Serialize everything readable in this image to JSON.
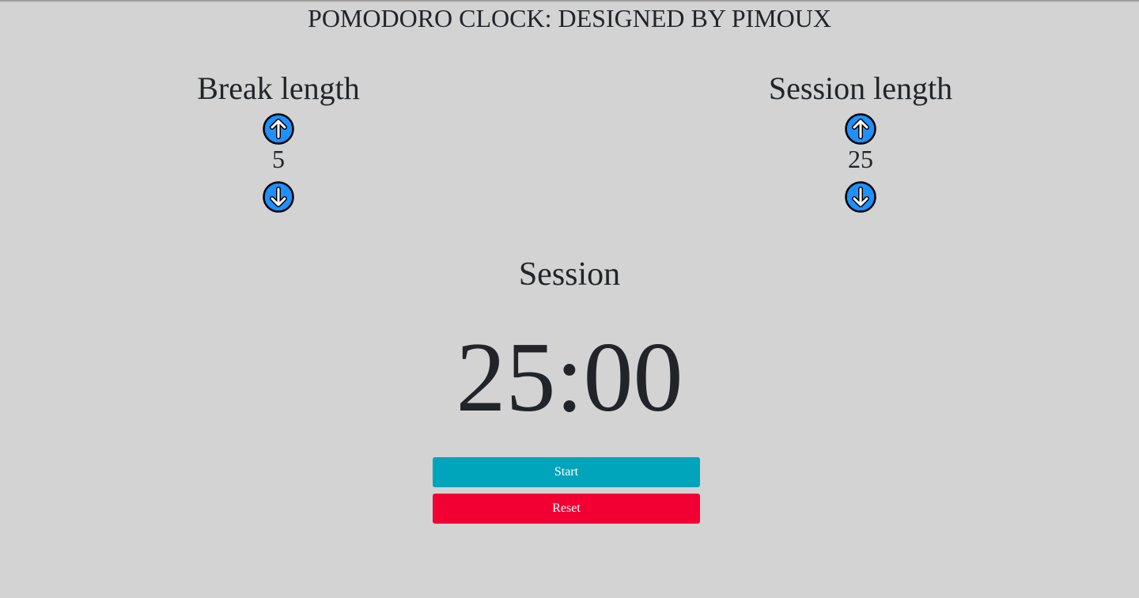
{
  "header": {
    "title": "POMODORO CLOCK: DESIGNED BY PIMOUX"
  },
  "break_control": {
    "label": "Break length",
    "value": "5"
  },
  "session_control": {
    "label": "Session length",
    "value": "25"
  },
  "timer": {
    "label": "Session",
    "time": "25:00"
  },
  "buttons": {
    "start_label": "Start",
    "reset_label": "Reset"
  },
  "icons": {
    "increment": "arrow-up-circle-icon",
    "decrement": "arrow-down-circle-icon"
  },
  "colors": {
    "background": "#d3d3d3",
    "arrow_fill": "#1e90ff",
    "start": "#00a5bb",
    "reset": "#f20034"
  }
}
